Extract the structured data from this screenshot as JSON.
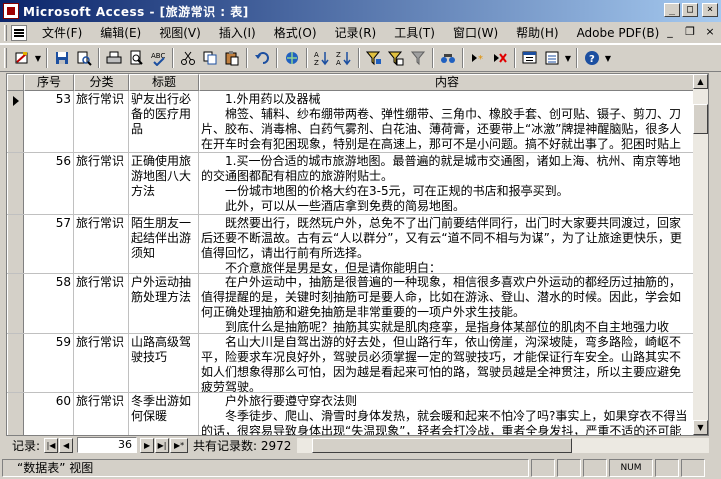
{
  "window": {
    "title": "Microsoft Access - [旅游常识 : 表]",
    "minimize": "_",
    "maximize": "□",
    "close": "×"
  },
  "menu": {
    "items": [
      "文件(F)",
      "编辑(E)",
      "视图(V)",
      "插入(I)",
      "格式(O)",
      "记录(R)",
      "工具(T)",
      "窗口(W)",
      "帮助(H)",
      "Adobe PDF(B)"
    ],
    "mdi_min": "_",
    "mdi_restore": "❐",
    "mdi_close": "×"
  },
  "toolbar": {
    "icons": [
      "view-icon",
      "save-icon",
      "search-icon",
      "print-icon",
      "print-preview-icon",
      "spell-check-icon",
      "cut-icon",
      "copy-icon",
      "paste-icon",
      "undo-icon",
      "hyperlink-icon",
      "sort-ascending-icon",
      "sort-descending-icon",
      "filter-by-selection-icon",
      "filter-by-form-icon",
      "apply-filter-icon",
      "find-icon",
      "new-record-icon",
      "delete-record-icon",
      "database-window-icon",
      "new-object-icon",
      "help-icon"
    ]
  },
  "columns": [
    "序号",
    "分类",
    "标题",
    "内容"
  ],
  "rows": [
    {
      "id": "53",
      "category": "旅行常识",
      "title": "驴友出行必备的医疗用品",
      "content": [
        "　　1.外用药以及器械",
        "　　棉签、辅料、纱布绷带两卷、弹性绷带、三角巾、橡胶手套、创可贴、镊子、剪刀、刀片、胶布、消毒棉、白药气雾剂、白花油、薄荷膏，还要带上“冰激”牌提神醒脑贴，很多人在开车时会有犯困现象，特别是在高速上，那可不是小问题。搞不好就出事了。犯困时贴上"
      ]
    },
    {
      "id": "56",
      "category": "旅行常识",
      "title": "正确使用旅游地图八大方法",
      "content": [
        "　　1.买一份合适的城市旅游地图。最普遍的就是城市交通图，诸如上海、杭州、南京等地的交通图都配有相应的旅游附贴士。",
        "　　一份城市地图的价格大约在3-5元，可在正规的书店和报亭买到。",
        "　　此外，可以从一些酒店拿到免费的简易地图。"
      ]
    },
    {
      "id": "57",
      "category": "旅行常识",
      "title": "陌生朋友一起结伴出游须知",
      "content": [
        "　　既然要出行，既然玩户外，总免不了出门前要结伴同行，出门时大家要共同渡过，回家后还要不断温故。古有云“人以群分”，又有云“道不同不相与为谋”，为了让旅途更快乐，更值得回忆，请出行前有所选择。",
        "　　不介意旅伴是男是女，但是请你能明白："
      ]
    },
    {
      "id": "58",
      "category": "旅行常识",
      "title": "户外运动抽筋处理方法",
      "content": [
        "　　在户外运动中，抽筋是很普遍的一种现象，相信很多喜欢户外运动的都经历过抽筋的，值得提醒的是，关键时刻抽筋可是要人命，比如在游泳、登山、潜水的时候。因此，学会如何正确处理抽筋和避免抽筋是非常重要的一项户外求生技能。",
        "　　到底什么是抽筋呢？抽筋其实就是肌肉痉挛，是指身体某部位的肌肉不自主地强力收缩，"
      ]
    },
    {
      "id": "59",
      "category": "旅行常识",
      "title": "山路高级驾驶技巧",
      "content": [
        "　　名山大川是自驾出游的好去处，但山路行车，依山傍崖，沟深坡陡，弯多路险，崎岖不平，险要求车况良好外，驾驶员必须掌握一定的驾驶技巧，才能保证行车安全。山路其实不如人们想象得那么可怕，因为越是看起来可怕的路，驾驶员越是全神贯注，所以主要应避免疲劳驾驶。"
      ]
    },
    {
      "id": "60",
      "category": "旅行常识",
      "title": "冬季出游如何保暖",
      "content": [
        "　　户外旅行要遵守穿衣法则",
        "　　冬季徒步、爬山、滑雪时身体发热，就会暖和起来不怕冷了吗?事实上，如果穿衣不得当的话，很容易导致身体出现“失温现象”，轻者会打冷战，重者全身发抖，严重不适的还可能导致生命危险。"
      ]
    }
  ],
  "navigation": {
    "label": "记录:",
    "first": "|◀",
    "prev": "◀",
    "current": "36",
    "next": "▶",
    "last": "▶|",
    "new": "▶*",
    "total": "共有记录数: 2972"
  },
  "status": {
    "view_text": "“数据表” 视图",
    "num": "NUM"
  }
}
